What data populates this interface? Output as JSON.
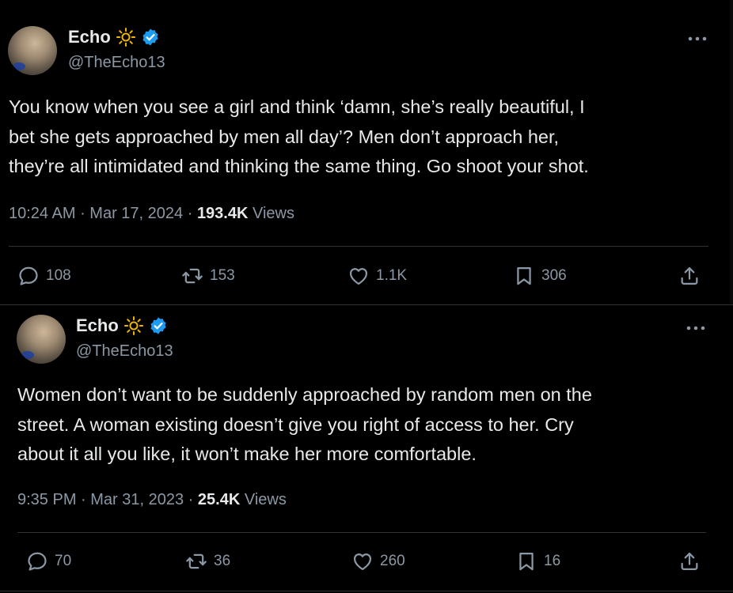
{
  "tweets": [
    {
      "author": {
        "name": "Echo",
        "handle": "@TheEcho13",
        "badge_emoji_icon": "sun-icon",
        "verified_icon": "verified-badge-icon"
      },
      "text": "You know when you see a girl and think ‘damn, she’s really beautiful, I\nbet she gets approached by men all day’? Men don’t approach her,\nthey’re all intimidated and thinking the same thing. Go shoot your shot.",
      "time": "10:24 AM",
      "date": "Mar 17, 2024",
      "views_count": "193.4K",
      "views_label": "Views",
      "stats": {
        "replies": "108",
        "reposts": "153",
        "likes": "1.1K",
        "bookmarks": "306"
      }
    },
    {
      "author": {
        "name": "Echo",
        "handle": "@TheEcho13",
        "badge_emoji_icon": "sun-icon",
        "verified_icon": "verified-badge-icon"
      },
      "text": "Women don’t want to be suddenly approached by random men on the\nstreet. A woman existing doesn’t give you right of access to her. Cry\nabout it all you like, it won’t make her more comfortable.",
      "time": "9:35 PM",
      "date": "Mar 31, 2023",
      "views_count": "25.4K",
      "views_label": "Views",
      "stats": {
        "replies": "70",
        "reposts": "36",
        "likes": "260",
        "bookmarks": "16"
      }
    }
  ],
  "separator": " · ",
  "colors": {
    "background": "#000000",
    "text": "#e7e9ea",
    "secondary": "#8b98a5",
    "verified": "#1d9bf0",
    "divider": "#2f3336"
  }
}
